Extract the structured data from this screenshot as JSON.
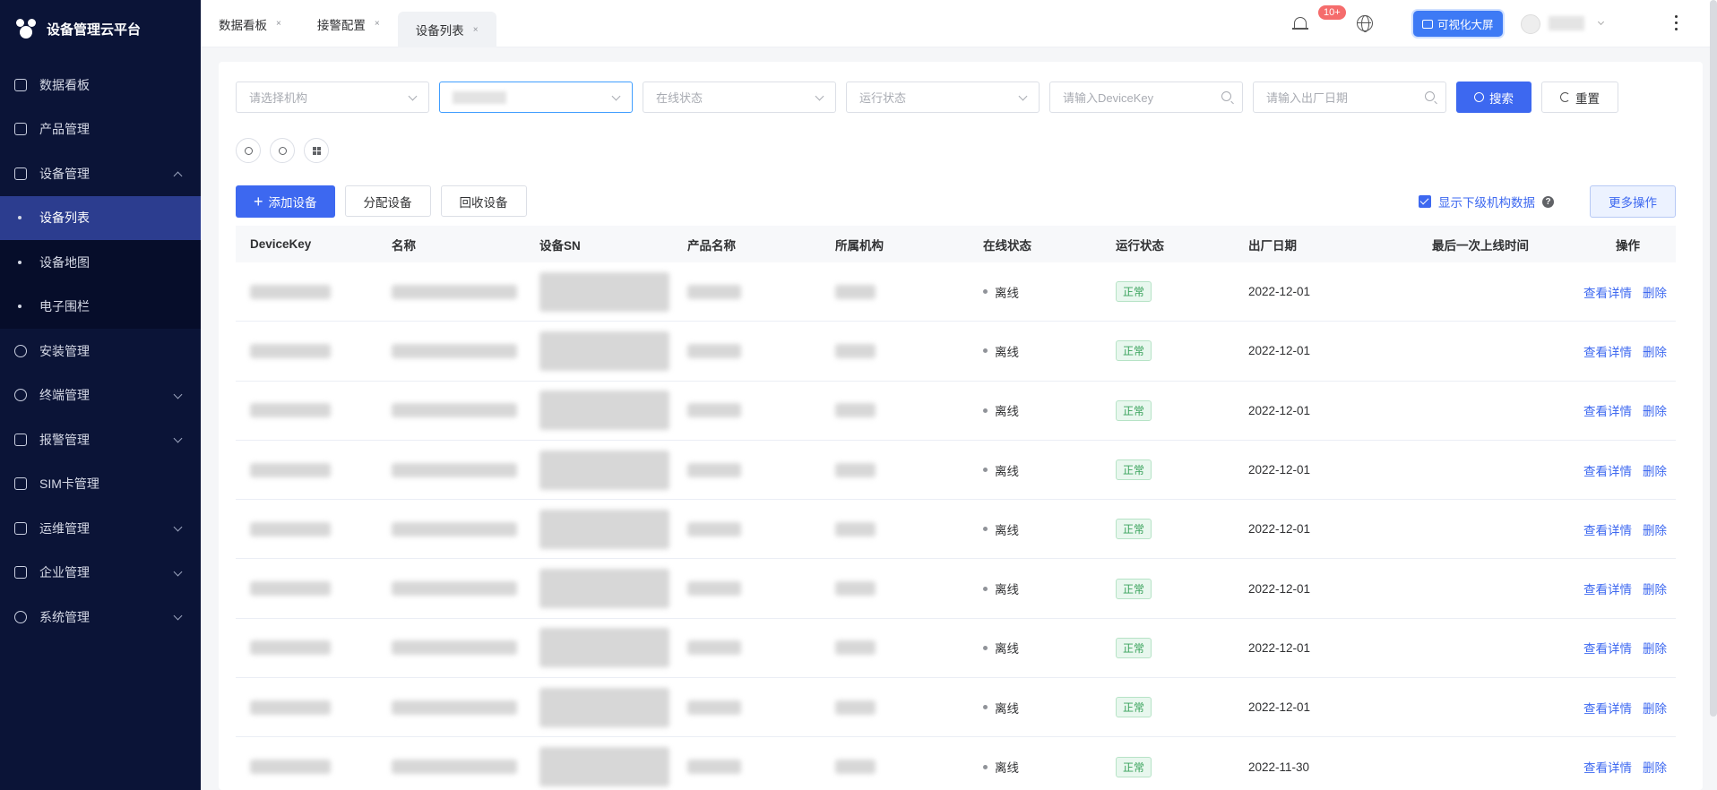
{
  "app": {
    "title": "设备管理云平台"
  },
  "sidebar": {
    "items": [
      {
        "label": "数据看板",
        "icon": "bar-chart-icon"
      },
      {
        "label": "产品管理",
        "icon": "cube-icon"
      },
      {
        "label": "设备管理",
        "icon": "layers-icon",
        "expanded": true,
        "children": [
          {
            "label": "设备列表",
            "active": true
          },
          {
            "label": "设备地图"
          },
          {
            "label": "电子围栏"
          }
        ]
      },
      {
        "label": "安装管理",
        "icon": "install-icon"
      },
      {
        "label": "终端管理",
        "icon": "user-icon",
        "arrow": true
      },
      {
        "label": "报警管理",
        "icon": "alarm-icon",
        "arrow": true
      },
      {
        "label": "SIM卡管理",
        "icon": "sim-icon"
      },
      {
        "label": "运维管理",
        "icon": "maintenance-icon",
        "arrow": true
      },
      {
        "label": "企业管理",
        "icon": "building-icon",
        "arrow": true
      },
      {
        "label": "系统管理",
        "icon": "gear-icon",
        "arrow": true
      }
    ]
  },
  "tabs": [
    {
      "label": "数据看板",
      "close": "×"
    },
    {
      "label": "接警配置",
      "close": "×"
    },
    {
      "label": "设备列表",
      "close": "×",
      "active": true
    }
  ],
  "header": {
    "badge": "10+",
    "viz_button": "可视化大屏"
  },
  "filters": {
    "org_placeholder": "请选择机构",
    "online_placeholder": "在线状态",
    "run_placeholder": "运行状态",
    "devicekey_placeholder": "请输入DeviceKey",
    "date_placeholder": "请输入出厂日期",
    "search_label": "搜索",
    "reset_label": "重置"
  },
  "actions": {
    "add_label": "添加设备",
    "assign_label": "分配设备",
    "recycle_label": "回收设备",
    "show_sub_label": "显示下级机构数据",
    "more_label": "更多操作"
  },
  "table": {
    "columns": [
      "DeviceKey",
      "名称",
      "设备SN",
      "产品名称",
      "所属机构",
      "在线状态",
      "运行状态",
      "出厂日期",
      "最后一次上线时间",
      "操作"
    ],
    "rows": [
      {
        "online": "离线",
        "run": "正常",
        "date": "2022-12-01"
      },
      {
        "online": "离线",
        "run": "正常",
        "date": "2022-12-01"
      },
      {
        "online": "离线",
        "run": "正常",
        "date": "2022-12-01"
      },
      {
        "online": "离线",
        "run": "正常",
        "date": "2022-12-01"
      },
      {
        "online": "离线",
        "run": "正常",
        "date": "2022-12-01"
      },
      {
        "online": "离线",
        "run": "正常",
        "date": "2022-12-01"
      },
      {
        "online": "离线",
        "run": "正常",
        "date": "2022-12-01"
      },
      {
        "online": "离线",
        "run": "正常",
        "date": "2022-12-01"
      },
      {
        "online": "离线",
        "run": "正常",
        "date": "2022-11-30"
      }
    ],
    "view_label": "查看详情",
    "delete_label": "删除"
  },
  "colors": {
    "sidebar": "#0b1437",
    "active_menu": "#2c3d8f",
    "primary": "#3d68f0"
  }
}
